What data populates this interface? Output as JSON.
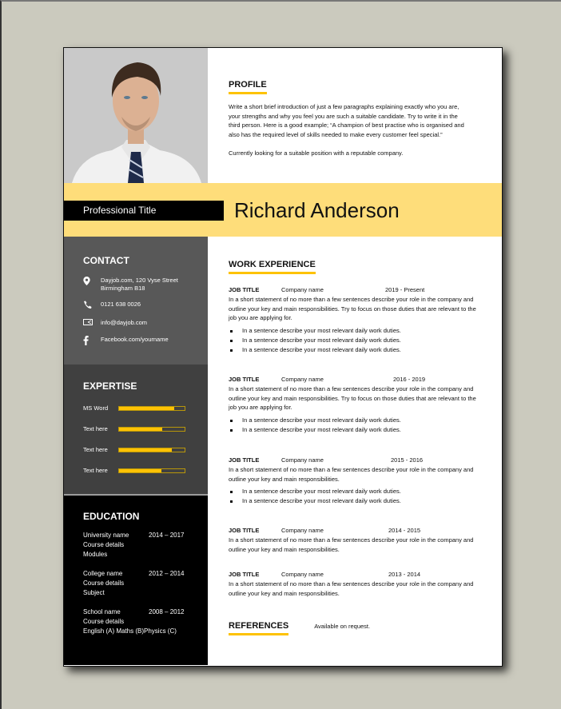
{
  "header": {
    "name": "Richard Anderson",
    "professional_title": "Professional Title",
    "photo_alt": "Portrait photo of man in white shirt and striped tie"
  },
  "profile": {
    "heading": "PROFILE",
    "paragraph1": "Write a short brief introduction of just a few paragraphs explaining exactly who you are, your strengths and why you feel you are such a suitable candidate. Try to write it in the third person. Here is a good example; “A champion of best practise who is organised and also has the required level of skills needed to make every customer feel special.”",
    "paragraph2": "Currently looking for a suitable position with a reputable company."
  },
  "contact": {
    "heading": "CONTACT",
    "items": [
      {
        "icon": "map-pin-icon",
        "line1": "Dayjob.com, 120 Vyse Street",
        "line2": "Birmingham B18"
      },
      {
        "icon": "phone-icon",
        "line1": "0121 638 0026",
        "line2": ""
      },
      {
        "icon": "email-icon",
        "line1": "info@dayjob.com",
        "line2": ""
      },
      {
        "icon": "facebook-icon",
        "line1": "Facebook.com/yourname",
        "line2": ""
      }
    ]
  },
  "expertise": {
    "heading": "EXPERTISE",
    "skills": [
      {
        "label": "MS Word",
        "level": 0.84
      },
      {
        "label": "Text here",
        "level": 0.66
      },
      {
        "label": "Text here",
        "level": 0.81
      },
      {
        "label": "Text here",
        "level": 0.65
      }
    ]
  },
  "education": {
    "heading": "EDUCATION",
    "entries": [
      {
        "name": "University name",
        "years": "2014 – 2017",
        "line2": "Course details",
        "line3": "Modules"
      },
      {
        "name": "College name",
        "years": "2012 – 2014",
        "line2": "Course details",
        "line3": "Subject"
      },
      {
        "name": "School name",
        "years": "2008 – 2012",
        "line2": "Course details",
        "line3": "English (A) Maths (B)Physics (C)"
      }
    ]
  },
  "work": {
    "heading": "WORK EXPERIENCE",
    "jobs": [
      {
        "title": "JOB TITLE",
        "company": "Company name",
        "dates": "2019 - Present",
        "description": "In a short statement of no more than a few sentences describe your role in the company and outline your key and main responsibilities. Try to focus on those duties that are relevant to the job you are applying for.",
        "bullets": [
          "In a sentence describe your most relevant daily work duties.",
          "In a sentence describe your most relevant daily work duties.",
          "In a sentence describe your most relevant daily work duties."
        ]
      },
      {
        "title": "JOB TITLE",
        "company": "Company name",
        "dates": "2016 - 2019",
        "description": "In a short statement of no more than a few sentences describe your role in the company and outline your key and main responsibilities. Try to focus on those duties that are relevant to the job you are applying for.",
        "bullets": [
          "In a sentence describe your most relevant daily work duties.",
          "In a sentence describe your most relevant daily work duties."
        ]
      },
      {
        "title": "JOB TITLE",
        "company": "Company name",
        "dates": "2015 - 2016",
        "description": "In a short statement of no more than a few sentences describe your role in the company and outline your key and main responsibilities.",
        "bullets": [
          "In a sentence describe your most relevant daily work duties.",
          "In a sentence describe your most relevant daily work duties."
        ]
      },
      {
        "title": "JOB TITLE",
        "company": "Company name",
        "dates": "2014 - 2015",
        "description": "In a short statement of no more than a few sentences describe your role in the company and outline your key and main responsibilities.",
        "bullets": []
      },
      {
        "title": "JOB TITLE",
        "company": "Company name",
        "dates": "2013 - 2014",
        "description": "In a short statement of no more than a few sentences describe your role in the company and outline your key and main responsibilities.",
        "bullets": []
      }
    ]
  },
  "references": {
    "heading": "REFERENCES",
    "text": "Available on request."
  },
  "colors": {
    "accent_yellow": "#fdc204",
    "band_yellow": "#fedd7a",
    "contact_bg": "#585858",
    "expertise_bg": "#404040",
    "education_bg": "#000000"
  }
}
